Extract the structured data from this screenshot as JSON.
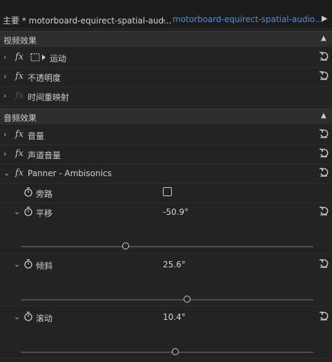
{
  "tabs": {
    "main_clip": "主要 * motorboard-equirect-spatial-aud...",
    "sequence": "motorboard-equirect-spatial-audio..."
  },
  "video_effects": {
    "title": "视频效果",
    "items": [
      {
        "label": "运动"
      },
      {
        "label": "不透明度"
      },
      {
        "label": "时间重映射"
      }
    ]
  },
  "audio_effects": {
    "title": "音频效果",
    "items": [
      {
        "label": "音量"
      },
      {
        "label": "声道音量"
      },
      {
        "label": "Panner - Ambisonics"
      }
    ]
  },
  "panner": {
    "bypass": {
      "label": "旁路",
      "checked": false
    },
    "pan": {
      "label": "平移",
      "value": "-50.9°",
      "slider_fraction": 0.36
    },
    "tilt": {
      "label": "倾斜",
      "value": "25.6°",
      "slider_fraction": 0.57
    },
    "roll": {
      "label": "滚动",
      "value": "10.4°",
      "slider_fraction": 0.53
    }
  }
}
